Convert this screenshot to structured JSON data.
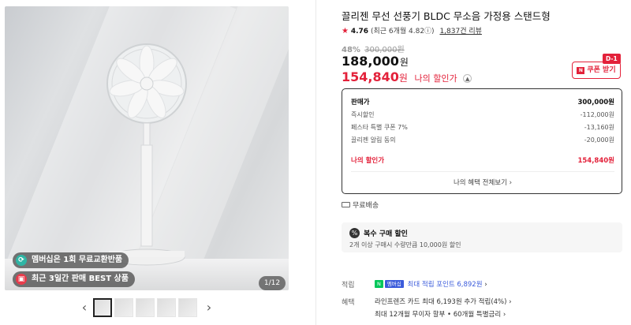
{
  "gallery": {
    "badges": [
      "멤버십은 1회 무료교환반품",
      "최근 3일간 판매 BEST 상품"
    ],
    "counter": "1/12",
    "prev_arrow": "‹",
    "next_arrow": "›"
  },
  "product": {
    "title": "끌리젠 무선 선풍기 BLDC 무소음 가정용 스탠드형",
    "rating": "4.76",
    "rating_detail": "(최근 6개월 4.82ⓘ)",
    "review_count": "1,837건 리뷰",
    "discount_rate": "48%",
    "original_price": "300,000원",
    "price": "188,000",
    "price_unit": "원",
    "my_price": "154,840",
    "my_price_unit": "원",
    "my_price_label": "나의 할인가",
    "coupon_label": "쿠폰 받기",
    "coupon_icon": "N",
    "dday": "D-1"
  },
  "price_box": {
    "rows": [
      {
        "label": "판매가",
        "value": "300,000원"
      },
      {
        "label": "즉시할인",
        "value": "-112,000원"
      },
      {
        "label": "페스타 특별 쿠폰 7%",
        "value": "-13,160원"
      },
      {
        "label": "끌리젠 알림 동의",
        "value": "-20,000원"
      },
      {
        "label": "나의 할인가",
        "value": "154,840원"
      }
    ],
    "benefit_all": "나의 혜택 전체보기 ›"
  },
  "shipping": "무료배송",
  "multi_buy": {
    "title": "복수 구매 할인",
    "desc": "2개 이상 구매시 수량만큼 10,000원 할인"
  },
  "benefits": {
    "point_label": "적립",
    "point_badge_1": "N",
    "point_badge_2": "멤버십",
    "point_text": "최대 적립 포인트 6,892원",
    "point_arrow": "›",
    "benefit_label": "혜택",
    "card_text": "라인프렌즈 카드 최대 6,193원 추가 적립(4%) ›",
    "installment_text": "최대 12개월 무이자 할부 • 60개월 특별금리 ›"
  }
}
